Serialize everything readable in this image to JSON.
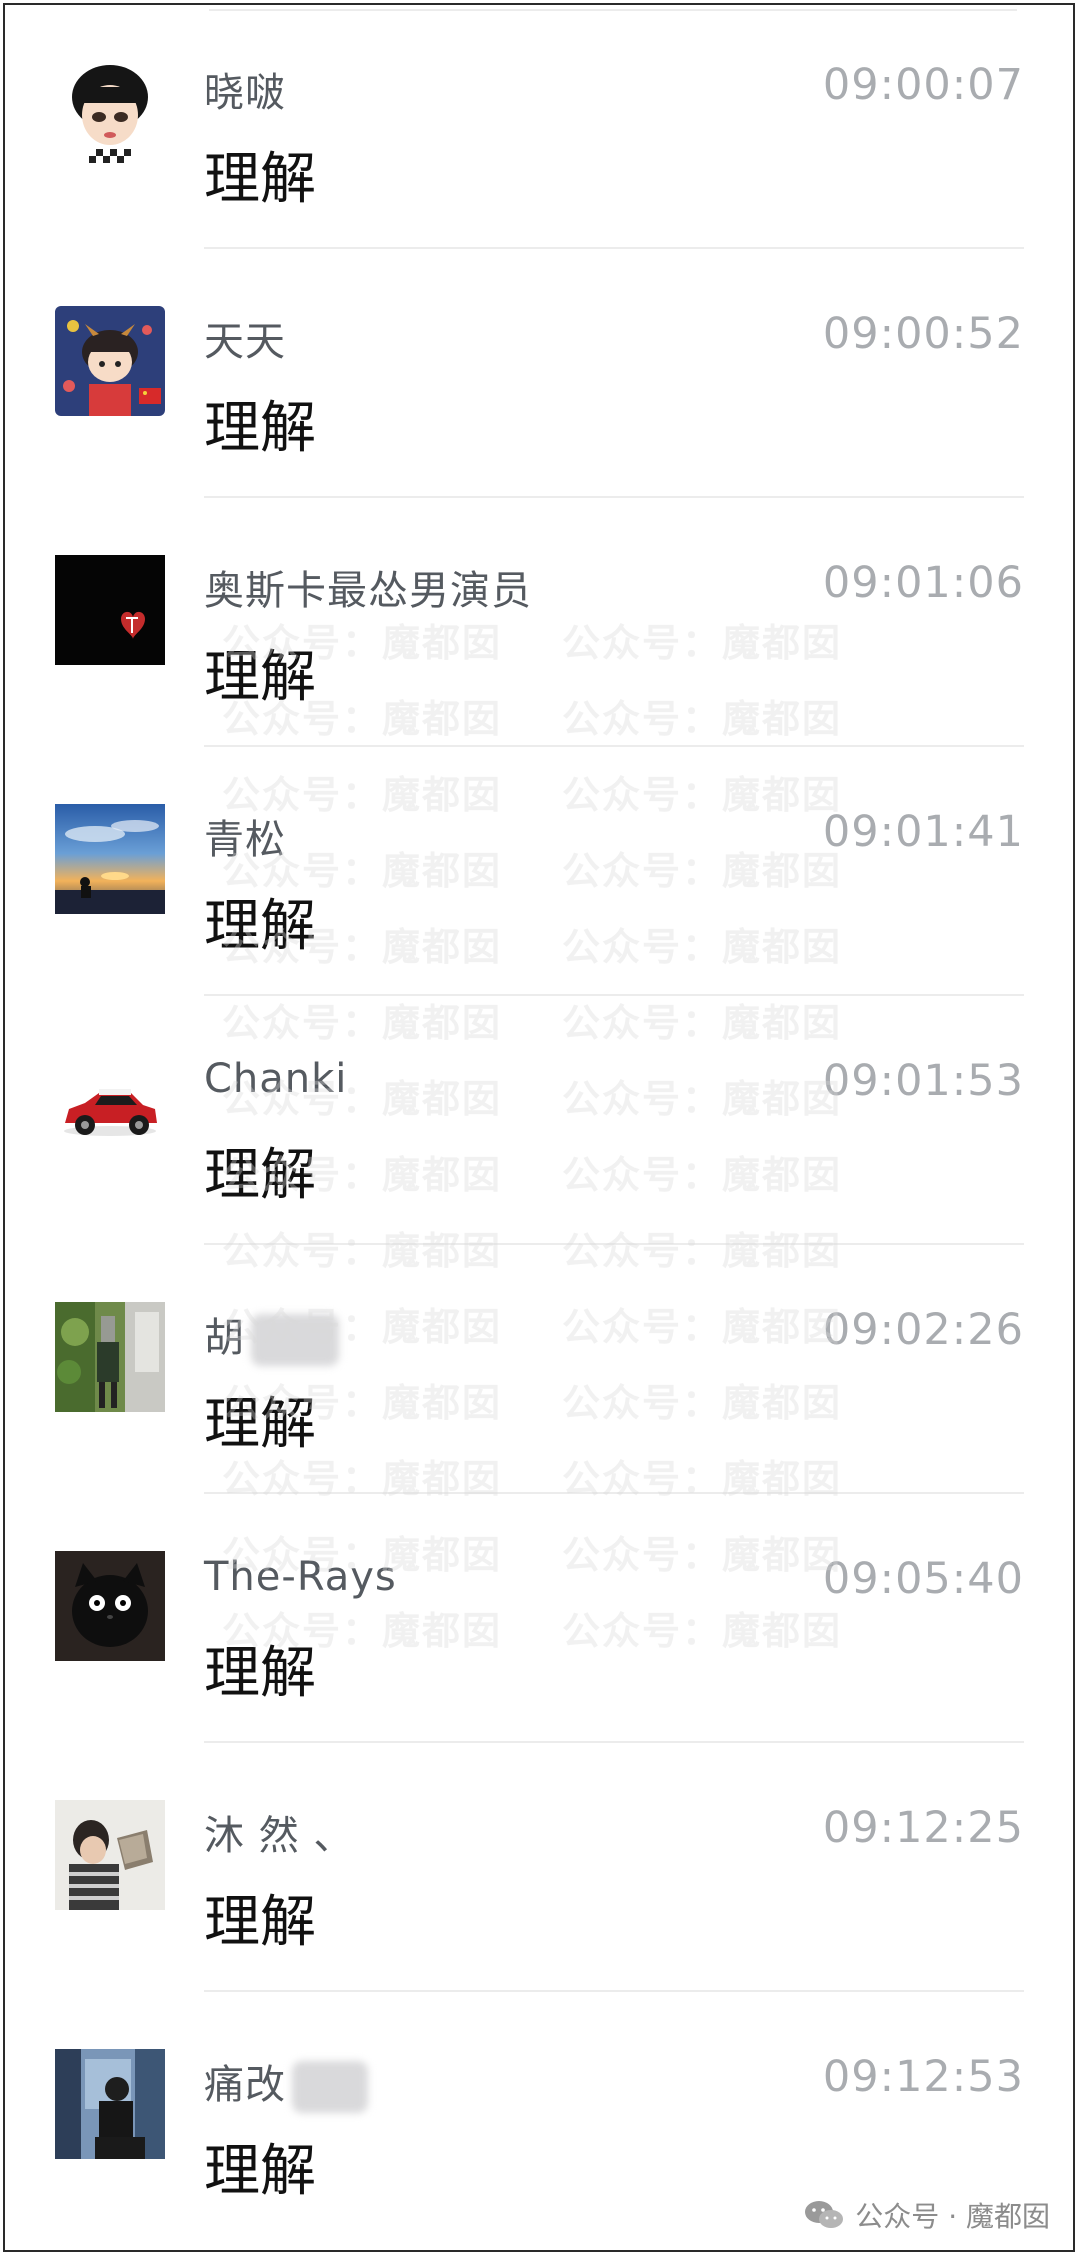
{
  "chat_list": {
    "rows": [
      {
        "name": "晓啵",
        "time": "09:00:07",
        "message": "理解",
        "avatar": "cartoon-girl-avatar"
      },
      {
        "name": "天天",
        "time": "09:00:52",
        "message": "理解",
        "avatar": "cartoon-kid-avatar"
      },
      {
        "name": "奥斯卡最怂男演员",
        "time": "09:01:06",
        "message": "理解",
        "avatar": "black-heart-avatar"
      },
      {
        "name": "青松",
        "time": "09:01:41",
        "message": "理解",
        "avatar": "sunset-avatar"
      },
      {
        "name": "Chanki",
        "time": "09:01:53",
        "message": "理解",
        "avatar": "red-car-avatar"
      },
      {
        "name": "胡",
        "time": "09:02:26",
        "message": "理解",
        "avatar": "outdoor-photo-avatar"
      },
      {
        "name": "The-Rays",
        "time": "09:05:40",
        "message": "理解",
        "avatar": "black-cat-avatar"
      },
      {
        "name": "沐 然 、",
        "time": "09:12:25",
        "message": "理解",
        "avatar": "child-photo-avatar"
      },
      {
        "name": "痛改",
        "time": "09:12:53",
        "message": "理解",
        "avatar": "person-photo-avatar"
      }
    ]
  },
  "watermark": {
    "text": "公众号：魔都囡",
    "footer_text": "公众号 · 魔都囡"
  },
  "colors": {
    "name": "#555a60",
    "time": "#a9acb0",
    "message": "#111111",
    "divider": "#ececec"
  }
}
